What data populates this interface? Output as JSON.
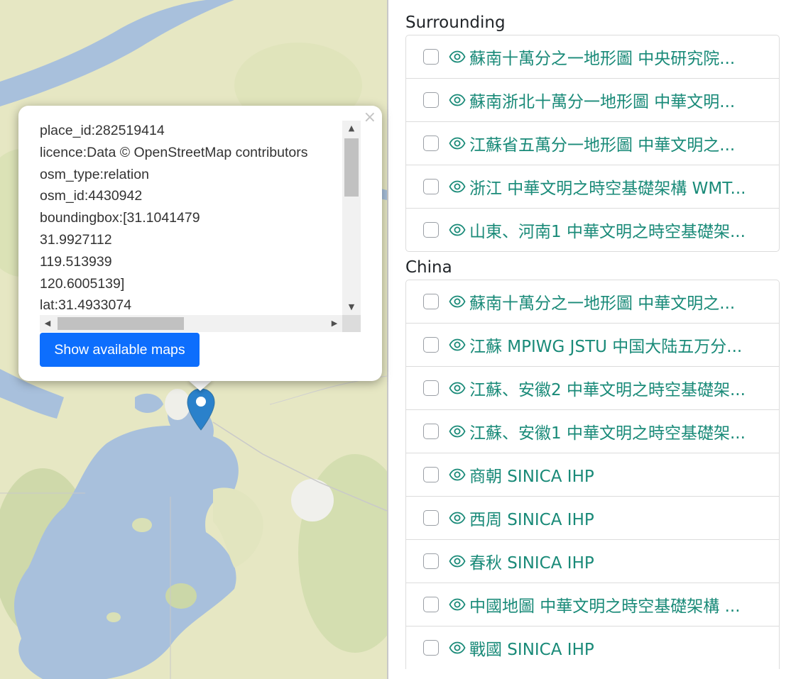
{
  "popup": {
    "close_glyph": "×",
    "lines": [
      "place_id:282519414",
      "licence:Data © OpenStreetMap contributors",
      "osm_type:relation",
      "osm_id:4430942",
      "boundingbox:[31.1041479",
      "31.9927112",
      "119.513939",
      "120.6005139]",
      "lat:31.4933074"
    ],
    "button_label": "Show available maps"
  },
  "marker_icon": "map-pin-icon",
  "panel": {
    "surrounding": {
      "title": "Surrounding",
      "items": [
        "蘇南十萬分之一地形圖 中央研究院...",
        "蘇南浙北十萬分一地形圖 中華文明...",
        "江蘇省五萬分一地形圖 中華文明之...",
        "浙江 中華文明之時空基礎架構 WMT...",
        "山東、河南1 中華文明之時空基礎架..."
      ]
    },
    "china": {
      "title": "China",
      "items": [
        "蘇南十萬分之一地形圖 中華文明之...",
        "江蘇 MPIWG JSTU 中国大陆五万分...",
        "江蘇、安徽2 中華文明之時空基礎架...",
        "江蘇、安徽1 中華文明之時空基礎架...",
        "商朝 SINICA IHP",
        "西周 SINICA IHP",
        "春秋 SINICA IHP",
        "中國地圖 中華文明之時空基礎架構 ...",
        "戰國 SINICA IHP"
      ]
    }
  },
  "colors": {
    "link": "#198a78",
    "button": "#0d6efd",
    "marker": "#2a81cb",
    "water": "#a8c0dc",
    "land": "#e6e7c3"
  }
}
